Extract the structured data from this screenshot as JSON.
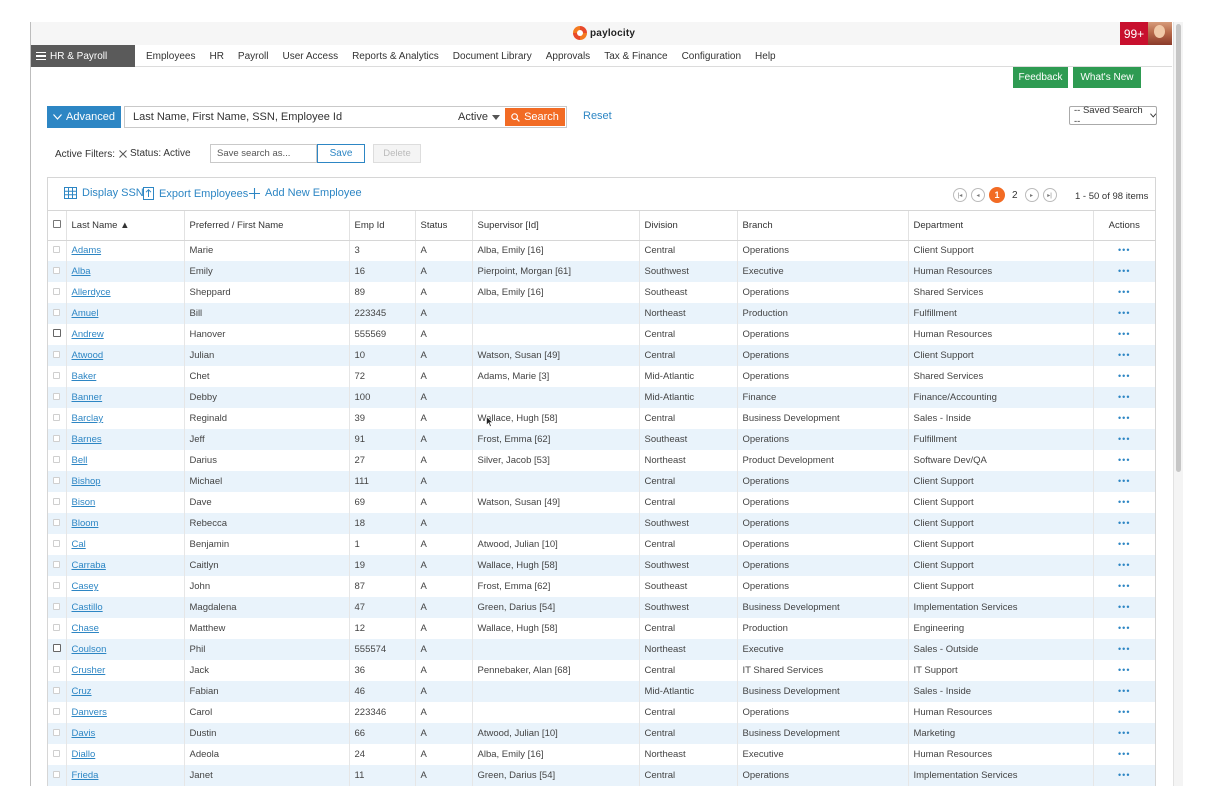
{
  "header": {
    "logo_text": "paylocity",
    "notification_count": "99+"
  },
  "nav": {
    "module_label": "HR & Payroll",
    "links": [
      "Employees",
      "HR",
      "Payroll",
      "User Access",
      "Reports & Analytics",
      "Document Library",
      "Approvals",
      "Tax & Finance",
      "Configuration",
      "Help"
    ]
  },
  "actions": {
    "feedback": "Feedback",
    "whats_new": "What's New"
  },
  "search": {
    "advanced_label": "Advanced",
    "placeholder": "Last Name, First Name, SSN, Employee Id",
    "status_value": "Active",
    "search_label": "Search",
    "reset_label": "Reset",
    "saved_search": "-- Saved Search --"
  },
  "filters": {
    "label": "Active Filters:",
    "chip": "Status: Active",
    "save_placeholder": "Save search as...",
    "save_label": "Save",
    "delete_label": "Delete"
  },
  "toolbar": {
    "display_ssn": "Display SSN",
    "export": "Export Employees",
    "add_new": "Add New Employee",
    "current_page": "1",
    "next_page": "2",
    "item_count": "1 - 50 of 98 items"
  },
  "table": {
    "columns": [
      "Last Name ▲",
      "Preferred / First Name",
      "Emp Id",
      "Status",
      "Supervisor [Id]",
      "Division",
      "Branch",
      "Department",
      "Actions"
    ],
    "rows": [
      [
        "Adams",
        "Marie",
        "3",
        "A",
        "Alba, Emily [16]",
        "Central",
        "Operations",
        "Client Support"
      ],
      [
        "Alba",
        "Emily",
        "16",
        "A",
        "Pierpoint, Morgan [61]",
        "Southwest",
        "Executive",
        "Human Resources"
      ],
      [
        "Allerdyce",
        "Sheppard",
        "89",
        "A",
        "Alba, Emily [16]",
        "Southeast",
        "Operations",
        "Shared Services"
      ],
      [
        "Amuel",
        "Bill",
        "223345",
        "A",
        "",
        "Northeast",
        "Production",
        "Fulfillment"
      ],
      [
        "Andrew",
        "Hanover",
        "555569",
        "A",
        "",
        "Central",
        "Operations",
        "Human Resources"
      ],
      [
        "Atwood",
        "Julian",
        "10",
        "A",
        "Watson, Susan [49]",
        "Central",
        "Operations",
        "Client Support"
      ],
      [
        "Baker",
        "Chet",
        "72",
        "A",
        "Adams, Marie [3]",
        "Mid-Atlantic",
        "Operations",
        "Shared Services"
      ],
      [
        "Banner",
        "Debby",
        "100",
        "A",
        "",
        "Mid-Atlantic",
        "Finance",
        "Finance/Accounting"
      ],
      [
        "Barclay",
        "Reginald",
        "39",
        "A",
        "Wallace, Hugh [58]",
        "Central",
        "Business Development",
        "Sales - Inside"
      ],
      [
        "Barnes",
        "Jeff",
        "91",
        "A",
        "Frost, Emma [62]",
        "Southeast",
        "Operations",
        "Fulfillment"
      ],
      [
        "Bell",
        "Darius",
        "27",
        "A",
        "Silver, Jacob [53]",
        "Northeast",
        "Product Development",
        "Software Dev/QA"
      ],
      [
        "Bishop",
        "Michael",
        "111",
        "A",
        "",
        "Central",
        "Operations",
        "Client Support"
      ],
      [
        "Bison",
        "Dave",
        "69",
        "A",
        "Watson, Susan [49]",
        "Central",
        "Operations",
        "Client Support"
      ],
      [
        "Bloom",
        "Rebecca",
        "18",
        "A",
        "",
        "Southwest",
        "Operations",
        "Client Support"
      ],
      [
        "Cal",
        "Benjamin",
        "1",
        "A",
        "Atwood, Julian [10]",
        "Central",
        "Operations",
        "Client Support"
      ],
      [
        "Carraba",
        "Caitlyn",
        "19",
        "A",
        "Wallace, Hugh [58]",
        "Southwest",
        "Operations",
        "Client Support"
      ],
      [
        "Casey",
        "John",
        "87",
        "A",
        "Frost, Emma [62]",
        "Southeast",
        "Operations",
        "Client Support"
      ],
      [
        "Castillo",
        "Magdalena",
        "47",
        "A",
        "Green, Darius [54]",
        "Southwest",
        "Business Development",
        "Implementation Services"
      ],
      [
        "Chase",
        "Matthew",
        "12",
        "A",
        "Wallace, Hugh [58]",
        "Central",
        "Production",
        "Engineering"
      ],
      [
        "Coulson",
        "Phil",
        "555574",
        "A",
        "",
        "Northeast",
        "Executive",
        "Sales - Outside"
      ],
      [
        "Crusher",
        "Jack",
        "36",
        "A",
        "Pennebaker, Alan [68]",
        "Central",
        "IT Shared Services",
        "IT Support"
      ],
      [
        "Cruz",
        "Fabian",
        "46",
        "A",
        "",
        "Mid-Atlantic",
        "Business Development",
        "Sales - Inside"
      ],
      [
        "Danvers",
        "Carol",
        "223346",
        "A",
        "",
        "Central",
        "Operations",
        "Human Resources"
      ],
      [
        "Davis",
        "Dustin",
        "66",
        "A",
        "Atwood, Julian [10]",
        "Central",
        "Business Development",
        "Marketing"
      ],
      [
        "Diallo",
        "Adeola",
        "24",
        "A",
        "Alba, Emily [16]",
        "Northeast",
        "Executive",
        "Human Resources"
      ],
      [
        "Frieda",
        "Janet",
        "11",
        "A",
        "Green, Darius [54]",
        "Central",
        "Operations",
        "Implementation Services"
      ]
    ],
    "actions_glyph": "•••"
  },
  "colors": {
    "accent_blue": "#2d86c4",
    "search_orange": "#f26b24",
    "green": "#2e9b52",
    "alert_red": "#c8102e"
  }
}
